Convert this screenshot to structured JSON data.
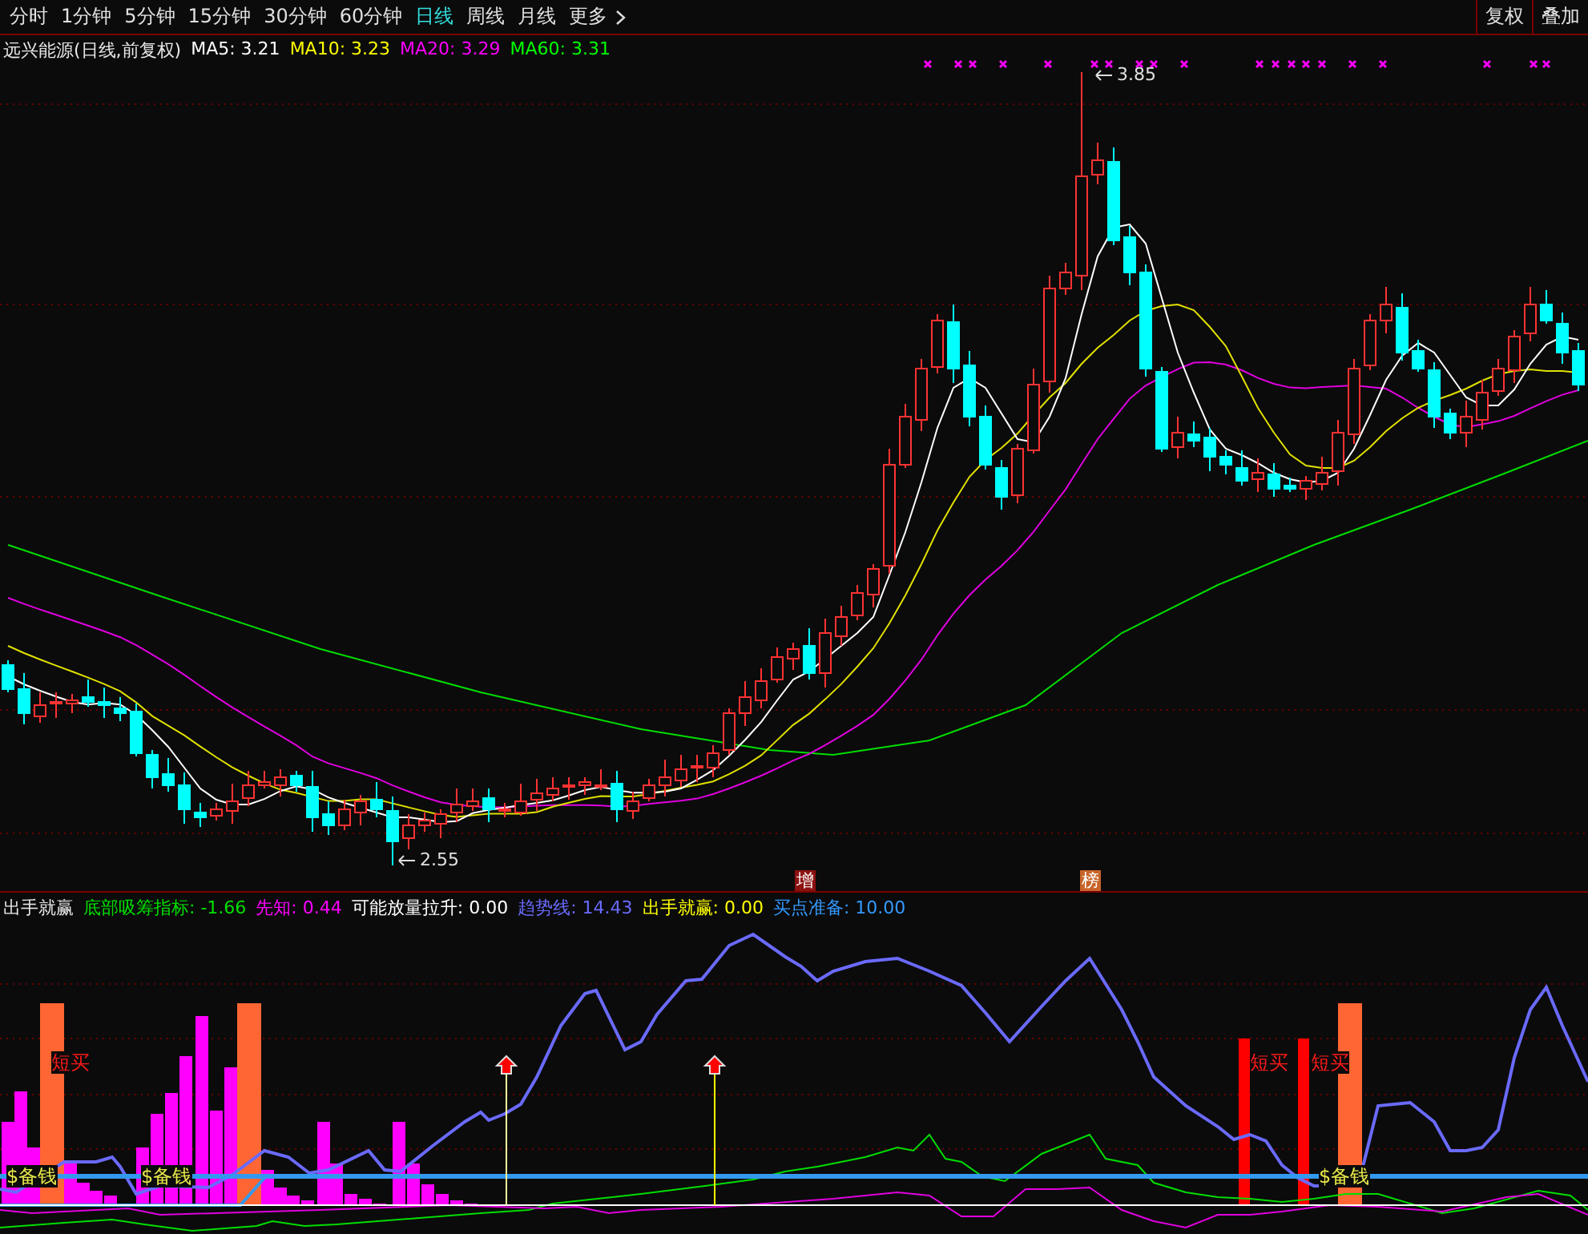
{
  "tabs": [
    {
      "label": "分时",
      "selected": false
    },
    {
      "label": "1分钟",
      "selected": false
    },
    {
      "label": "5分钟",
      "selected": false
    },
    {
      "label": "15分钟",
      "selected": false
    },
    {
      "label": "30分钟",
      "selected": false
    },
    {
      "label": "60分钟",
      "selected": false
    },
    {
      "label": "日线",
      "selected": true
    },
    {
      "label": "周线",
      "selected": false
    },
    {
      "label": "月线",
      "selected": false
    }
  ],
  "more": {
    "label": "更多"
  },
  "toolbar_buttons": [
    "复权",
    "叠加"
  ],
  "main_legend": {
    "title": "远兴能源(日线,前复权)",
    "items": [
      {
        "label": "MA5: 3.21",
        "color": "#ffffff"
      },
      {
        "label": "MA10: 3.23",
        "color": "#ffff00"
      },
      {
        "label": "MA20: 3.29",
        "color": "#ff00ff"
      },
      {
        "label": "MA60: 3.31",
        "color": "#00ff00"
      }
    ]
  },
  "price_marks": [
    {
      "label": "3.85",
      "kind": "high"
    },
    {
      "label": "2.55",
      "kind": "low"
    }
  ],
  "event_tags": [
    {
      "label": "增",
      "color": "#8b1010"
    },
    {
      "label": "榜",
      "color": "#c8642a"
    }
  ],
  "indicator_legend": {
    "title": "出手就赢",
    "items": [
      {
        "label": "底部吸筹指标: -1.66",
        "color": "#00e000"
      },
      {
        "label": "先知: 0.44",
        "color": "#ff00ff"
      },
      {
        "label": "可能放量拉升: 0.00",
        "color": "#ffffff"
      },
      {
        "label": "趋势线: 14.43",
        "color": "#6a6aff"
      },
      {
        "label": "出手就赢: 0.00",
        "color": "#ffff00"
      },
      {
        "label": "买点准备: 10.00",
        "color": "#3399ff"
      }
    ]
  },
  "signals": [
    {
      "label": "短买",
      "kind": "buy"
    },
    {
      "label": "短买",
      "kind": "buy"
    },
    {
      "label": "短买",
      "kind": "buy"
    },
    {
      "label": "$备钱",
      "kind": "reserve"
    },
    {
      "label": "$备钱",
      "kind": "reserve"
    },
    {
      "label": "$备钱",
      "kind": "reserve"
    }
  ]
}
